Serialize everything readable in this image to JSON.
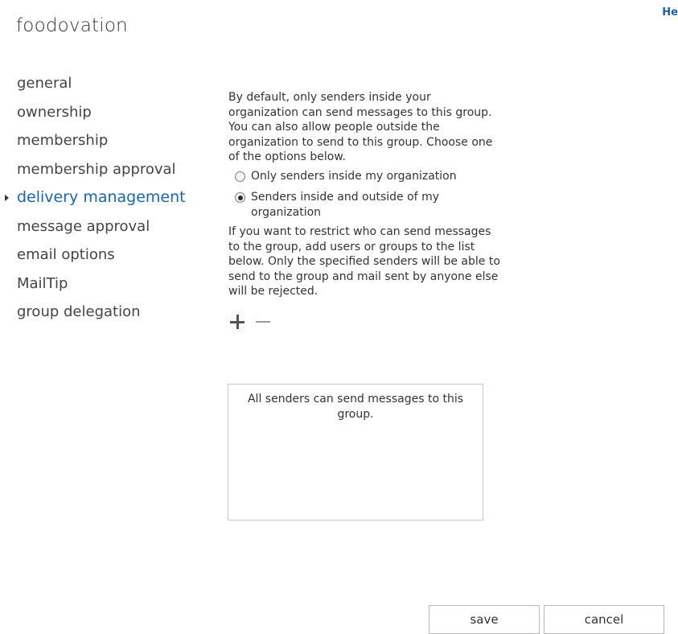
{
  "header": {
    "title": "foodovation",
    "help_label": "He"
  },
  "nav": {
    "items": [
      {
        "label": "general"
      },
      {
        "label": "ownership"
      },
      {
        "label": "membership"
      },
      {
        "label": "membership approval"
      },
      {
        "label": "delivery management",
        "active": true
      },
      {
        "label": "message approval"
      },
      {
        "label": "email options"
      },
      {
        "label": "MailTip"
      },
      {
        "label": "group delegation"
      }
    ]
  },
  "delivery": {
    "intro": "By default, only senders inside your organization can send messages to this group. You can also allow people outside the organization to send to this group. Choose one of the options below.",
    "options": [
      {
        "label": "Only senders inside my organization",
        "selected": false
      },
      {
        "label": "Senders inside and outside of my organization",
        "selected": true
      }
    ],
    "restrict_text": "If you want to restrict who can send messages to the group, add users or groups to the list below. Only the specified senders will be able to send to the group and mail sent by anyone else will be rejected.",
    "add_icon": "plus-icon",
    "remove_icon": "minus-icon",
    "empty_list_text": "All senders can send messages to this group."
  },
  "footer": {
    "save_label": "save",
    "cancel_label": "cancel"
  },
  "colors": {
    "accent": "#1a64b0",
    "text": "#333333",
    "border": "#c8c8c8"
  }
}
